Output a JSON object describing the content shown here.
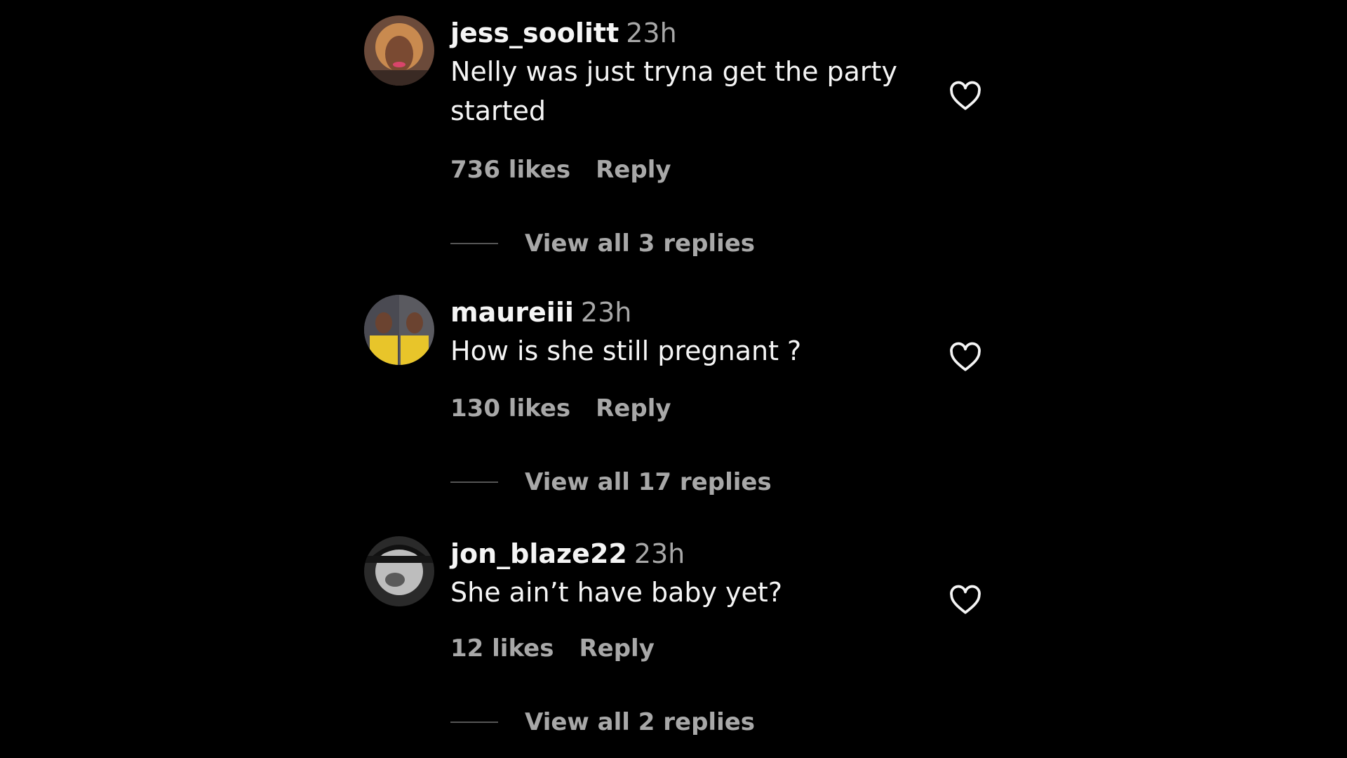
{
  "comments": [
    {
      "username": "jess_soolitt",
      "time": "23h",
      "text": "Nelly was just tryna get the party started",
      "likes": "736 likes",
      "reply_label": "Reply",
      "view_replies": "View all 3 replies"
    },
    {
      "username": "maureiii",
      "time": "23h",
      "text": "How is she still pregnant ?",
      "likes": "130 likes",
      "reply_label": "Reply",
      "view_replies": "View all 17 replies"
    },
    {
      "username": "jon_blaze22",
      "time": "23h",
      "text": "She ain’t have baby yet?",
      "likes": "12 likes",
      "reply_label": "Reply",
      "view_replies": "View all 2 replies"
    }
  ],
  "icons": {
    "like": "heart-outline-icon"
  },
  "colors": {
    "background": "#000000",
    "primary_text": "#f5f5f5",
    "secondary_text": "#a8a8a8"
  }
}
